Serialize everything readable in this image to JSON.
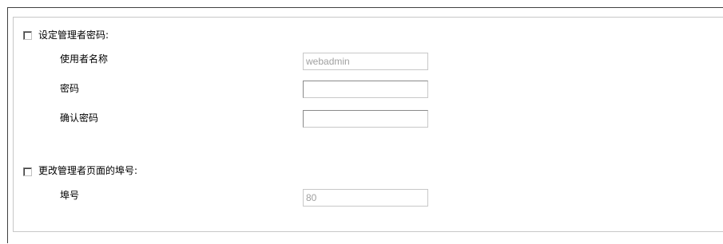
{
  "admin_password": {
    "checkbox_checked": false,
    "label": "设定管理者密码:",
    "fields": [
      {
        "label": "使用者名称",
        "value": "webadmin",
        "disabled": true
      },
      {
        "label": "密码",
        "value": "",
        "disabled": false
      },
      {
        "label": "确认密码",
        "value": "",
        "disabled": false
      }
    ]
  },
  "admin_port": {
    "checkbox_checked": false,
    "label": "更改管理者页面的埠号:",
    "fields": [
      {
        "label": "埠号",
        "value": "80",
        "disabled": true
      }
    ]
  }
}
